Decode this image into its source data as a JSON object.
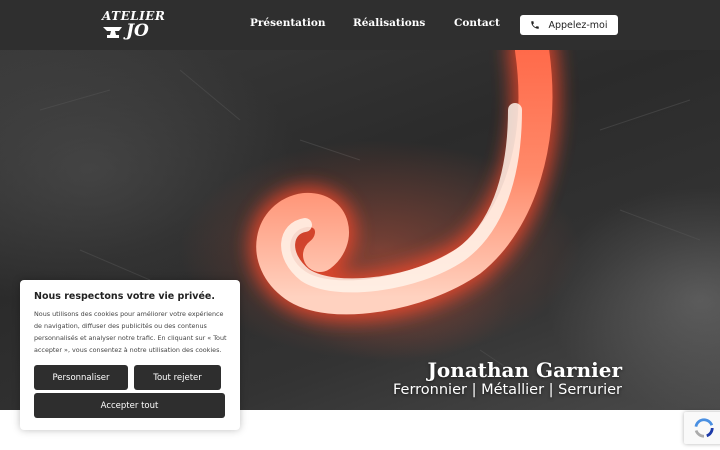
{
  "header": {
    "logo": {
      "line1": "ATELIER",
      "line2": "JO"
    },
    "nav": [
      {
        "label": "Présentation"
      },
      {
        "label": "Réalisations"
      },
      {
        "label": "Contact"
      }
    ],
    "call_button": {
      "label": "Appelez-moi",
      "icon": "phone-icon"
    }
  },
  "hero": {
    "title": "Jonathan Garnier",
    "subtitle": "Ferronnier | Métallier | Serrurier"
  },
  "cookie_banner": {
    "title": "Nous respectons votre vie privée.",
    "text": "Nous utilisons des cookies pour améliorer votre expérience de navigation, diffuser des publicités ou des contenus personnalisés et analyser notre trafic. En cliquant sur « Tout accepter », vous consentez à notre utilisation des cookies.",
    "customize_label": "Personnaliser",
    "reject_label": "Tout rejeter",
    "accept_label": "Accepter tout"
  },
  "recaptcha": {
    "icon": "recaptcha-icon"
  },
  "colors": {
    "header_bg": "#2f2f2f",
    "button_dark": "#2e2e2e",
    "glow": "#ff5a3c"
  }
}
